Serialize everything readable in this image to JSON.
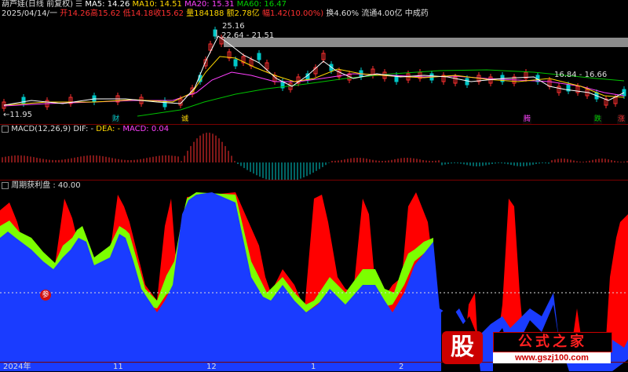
{
  "header": {
    "stock": "葫芦娃",
    "mode": "(日线 前复权)",
    "ma5": "MA5: 14.26",
    "ma10": "MA10: 14.51",
    "ma20": "MA20: 15.31",
    "ma60": "MA60: 16.47"
  },
  "ohlc": {
    "date": "2025/04/14/一",
    "open": "开14.26",
    "high": "高15.62",
    "low": "低14.18",
    "close": "收15.62",
    "volume": "量184188",
    "amount": "额2.78亿",
    "change": "幅1.42(10.00%)",
    "turnover": "换4.60%",
    "float_cap": "流通4.00亿",
    "sector": "中成药"
  },
  "price_labels": {
    "peak": "25.16",
    "box1": "22.64 - 21.51",
    "box2": "16.84 - 16.66",
    "low": "←11.95"
  },
  "markers": [
    "财",
    "诚",
    "腾",
    "跌",
    "涨"
  ],
  "macd": {
    "name": "MACD(12,26,9)",
    "dif": "DIF: -",
    "dea": "DEA: -",
    "macd": "MACD: 0.04"
  },
  "cycle": {
    "name": "周期获利盘",
    "value": ": 40.00",
    "badge": "参"
  },
  "xaxis": {
    "labels": [
      "2024年",
      "11",
      "12",
      "1",
      "2"
    ]
  },
  "watermark": {
    "logo": "股",
    "title": "公式之家",
    "url": "www.gszj100.com"
  },
  "colors": {
    "bg": "#000000",
    "up": "#ff3030",
    "down": "#00c8c8",
    "ma5": "#ffffff",
    "ma10": "#ffd700",
    "ma20": "#ff40ff",
    "ma60": "#00c000",
    "fill_red": "#ff0000",
    "fill_blue": "#1a3cff",
    "fill_green": "#7cff00"
  }
}
